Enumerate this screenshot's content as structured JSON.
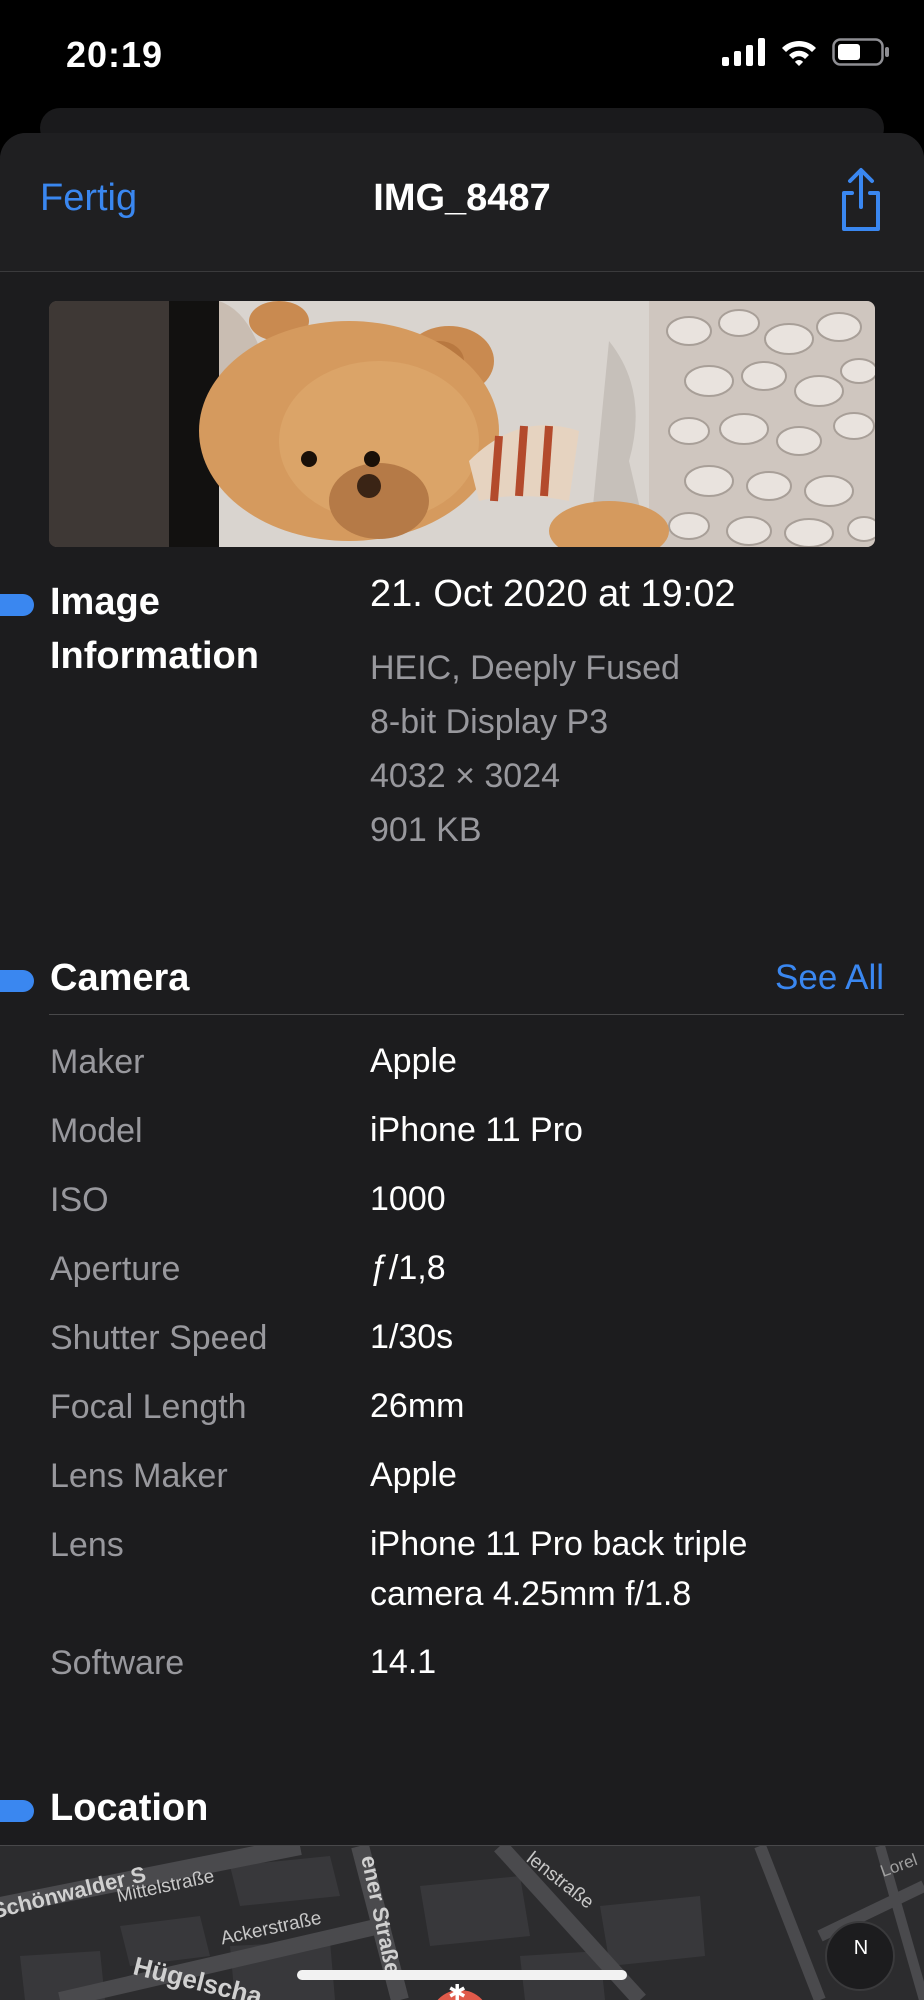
{
  "status_bar": {
    "time": "20:19"
  },
  "nav": {
    "done_label": "Fertig",
    "title": "IMG_8487",
    "share_icon": "share-icon"
  },
  "image_information": {
    "title_line1": "Image",
    "title_line2": "Information",
    "date": "21. Oct 2020 at 19:02",
    "format": "HEIC, Deeply Fused",
    "color_profile": "8-bit Display P3",
    "dimensions": "4032 × 3024",
    "file_size": "901 KB"
  },
  "camera": {
    "title": "Camera",
    "see_all_label": "See All",
    "rows": [
      {
        "label": "Maker",
        "value": "Apple"
      },
      {
        "label": "Model",
        "value": "iPhone 11 Pro"
      },
      {
        "label": "ISO",
        "value": "1000"
      },
      {
        "label": "Aperture",
        "value": "ƒ/1,8"
      },
      {
        "label": "Shutter Speed",
        "value": "1/30s"
      },
      {
        "label": "Focal Length",
        "value": "26mm"
      },
      {
        "label": "Lens Maker",
        "value": "Apple"
      },
      {
        "label": "Lens",
        "value": "iPhone 11 Pro back triple camera 4.25mm f/1.8"
      },
      {
        "label": "Software",
        "value": "14.1"
      }
    ]
  },
  "location": {
    "title": "Location",
    "streets": [
      "Schönwalder S",
      "Mittelstraße",
      "Ackerstraße",
      "Hügelscha",
      "ener Straße",
      "lenstraße",
      "Lorel"
    ],
    "compass_letter": "N"
  },
  "colors": {
    "accent": "#3a87f0",
    "sheet_bg": "#1c1c1e",
    "secondary_text": "#98989d"
  }
}
